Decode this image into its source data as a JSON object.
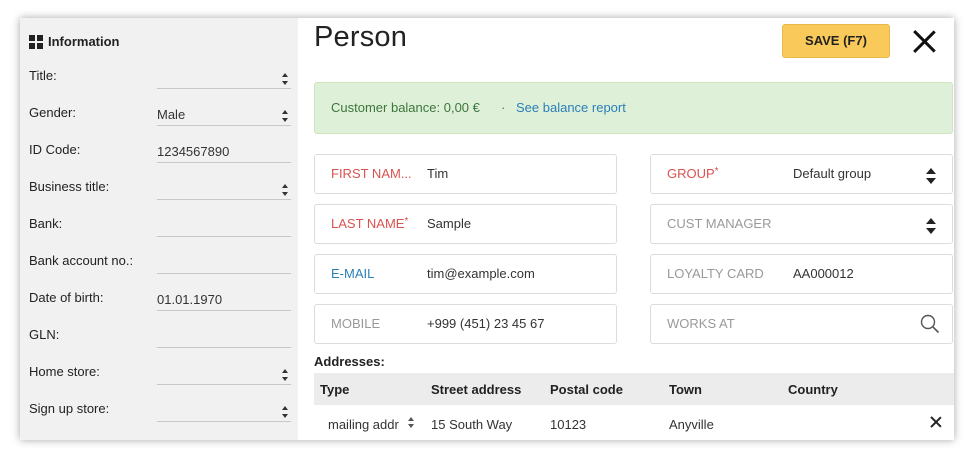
{
  "sidebar": {
    "header": "Information",
    "rows": [
      {
        "label": "Title:",
        "value": ""
      },
      {
        "label": "Gender:",
        "value": "Male"
      },
      {
        "label": "ID Code:",
        "value": "1234567890"
      },
      {
        "label": "Business title:",
        "value": ""
      },
      {
        "label": "Bank:",
        "value": ""
      },
      {
        "label": "Bank account no.:",
        "value": ""
      },
      {
        "label": "Date of birth:",
        "value": "01.01.1970"
      },
      {
        "label": "GLN:",
        "value": ""
      },
      {
        "label": "Home store:",
        "value": ""
      },
      {
        "label": "Sign up store:",
        "value": ""
      }
    ]
  },
  "header": {
    "title": "Person",
    "save_label": "SAVE (F7)"
  },
  "balance": {
    "text": "Customer balance: 0,00 €",
    "separator": "·",
    "link": "See balance report"
  },
  "fields": {
    "first_name": {
      "label": "FIRST NAM...",
      "value": "Tim"
    },
    "last_name": {
      "label": "LAST NAME",
      "required": "*",
      "value": "Sample"
    },
    "email": {
      "label": "E-MAIL",
      "value": "tim@example.com"
    },
    "mobile": {
      "label": "MOBILE",
      "value": "+999 (451) 23 45 67"
    },
    "group": {
      "label": "GROUP",
      "required": "*",
      "value": "Default group"
    },
    "cust_manager": {
      "label": "CUST MANAGER",
      "value": ""
    },
    "loyalty_card": {
      "label": "LOYALTY CARD",
      "value": "AA000012"
    },
    "works_at": {
      "label": "WORKS AT",
      "value": ""
    }
  },
  "addresses": {
    "title": "Addresses:",
    "columns": [
      "Type",
      "Street address",
      "Postal code",
      "Town",
      "Country"
    ],
    "rows": [
      {
        "type": "mailing addr",
        "street": "15 South Way",
        "postal": "10123",
        "town": "Anyville",
        "country": ""
      }
    ]
  },
  "colors": {
    "save_button": "#f9ca5a",
    "balance_bg": "#dff0d8",
    "required_label": "#d9534f",
    "link": "#2a7fb8"
  }
}
